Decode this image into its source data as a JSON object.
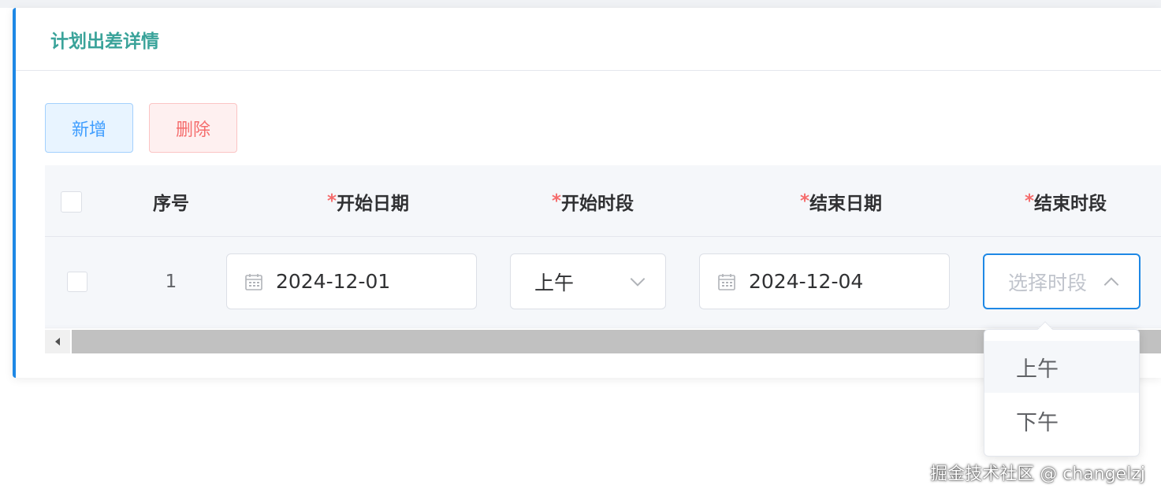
{
  "panel": {
    "title": "计划出差详情"
  },
  "toolbar": {
    "add_label": "新增",
    "delete_label": "删除"
  },
  "table": {
    "columns": {
      "index": "序号",
      "start_date": "开始日期",
      "start_period": "开始时段",
      "end_date": "结束日期",
      "end_period": "结束时段",
      "required_mark": "*"
    },
    "rows": [
      {
        "index": "1",
        "start_date": "2024-12-01",
        "start_period": "上午",
        "end_date": "2024-12-04",
        "end_period_placeholder": "选择时段"
      }
    ]
  },
  "dropdown": {
    "options": [
      "上午",
      "下午"
    ]
  },
  "watermark": "掘金技术社区 @ changelzj",
  "colors": {
    "accent": "#1e88e5",
    "title": "#3aa39a",
    "danger": "#f56c6c",
    "primary": "#409eff"
  }
}
